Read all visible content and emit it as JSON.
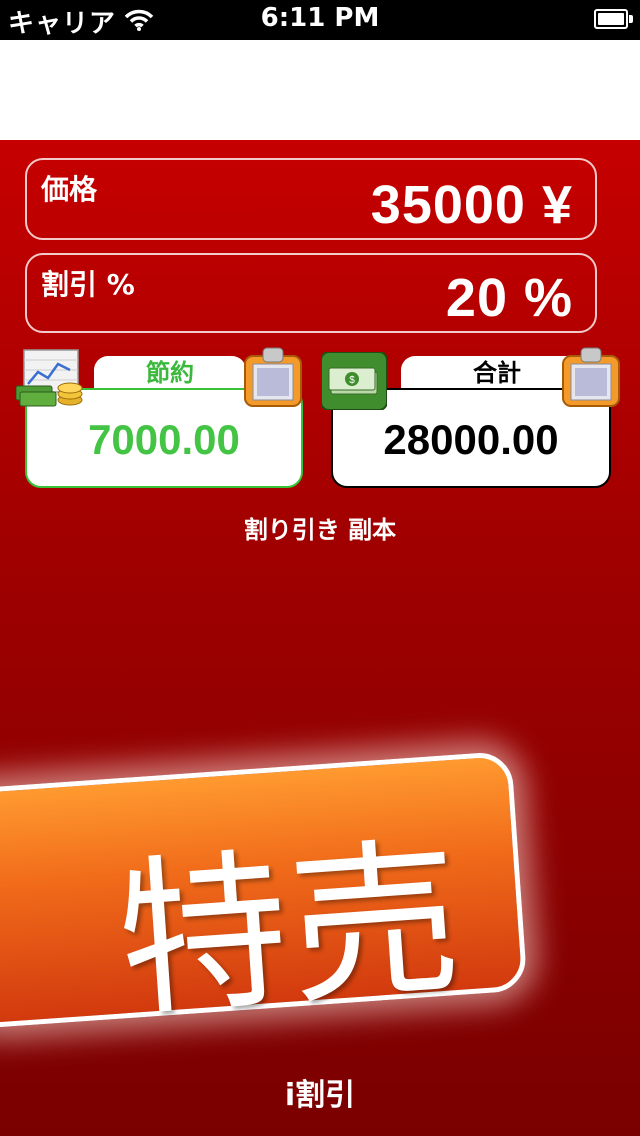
{
  "status_bar": {
    "carrier": "キャリア",
    "time": "6:11 PM"
  },
  "price": {
    "label": "価格",
    "value": "35000 ¥"
  },
  "discount": {
    "label": "割引 %",
    "value": "20 %"
  },
  "savings": {
    "label": "節約",
    "value": "7000.00"
  },
  "total": {
    "label": "合計",
    "value": "28000.00"
  },
  "copy_link": "割り引き 副本",
  "sale_badge": "特売",
  "app_name": "i割引",
  "colors": {
    "background_red": "#b00000",
    "savings_green": "#44c444",
    "badge_orange": "#f16c1a"
  },
  "icons": [
    "wifi-icon",
    "battery-icon",
    "chart-coins-icon",
    "money-icon",
    "clipboard-icon"
  ]
}
